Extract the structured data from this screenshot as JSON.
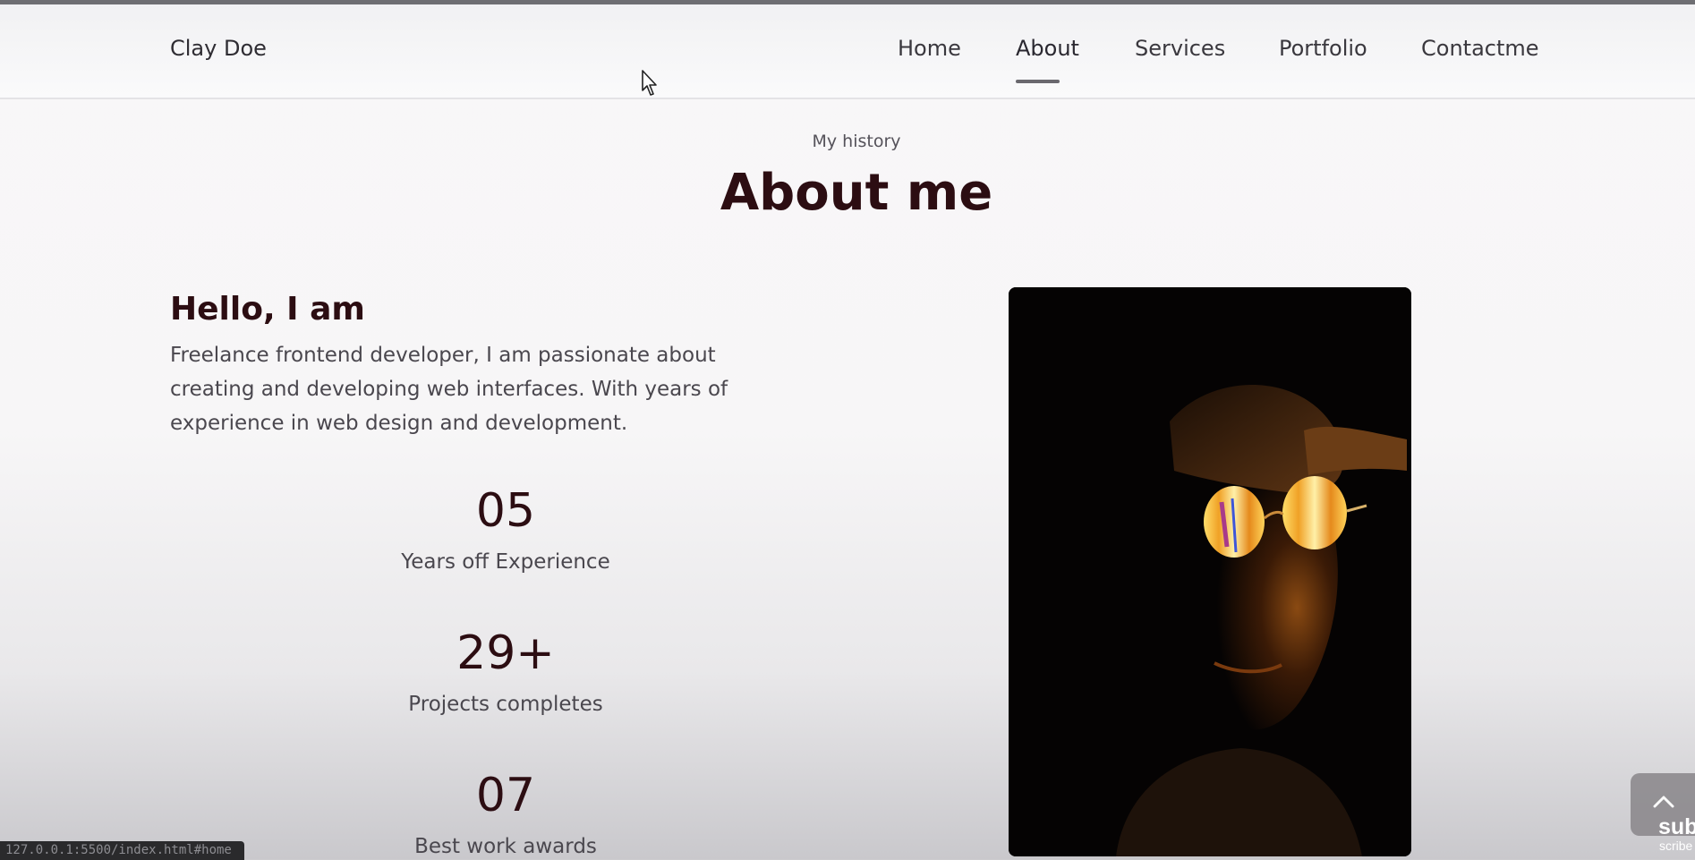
{
  "header": {
    "logo": "Clay Doe",
    "nav": [
      "Home",
      "About",
      "Services",
      "Portfolio",
      "Contactme"
    ],
    "active_nav": "About"
  },
  "section": {
    "subtitle": "My history",
    "title": "About me"
  },
  "intro": {
    "greeting": "Hello, I am",
    "description": "Freelance frontend developer, I am passionate about creating and developing web interfaces. With years of experience in web design and development."
  },
  "stats": [
    {
      "value": "05",
      "label": "Years off Experience"
    },
    {
      "value": "29+",
      "label": "Projects completes"
    },
    {
      "value": "07",
      "label": "Best work awards"
    }
  ],
  "status_bar": {
    "url": "127.0.0.1:5500/index.html#home"
  },
  "overlay": {
    "line1": "sub",
    "line2": "scribe"
  },
  "icons": {
    "scroll_top": "chevron-up-icon",
    "cursor": "mouse-pointer-icon"
  },
  "colors": {
    "heading": "#2c0d12",
    "body_text": "#4a474e",
    "background": "#f8f7f8"
  }
}
